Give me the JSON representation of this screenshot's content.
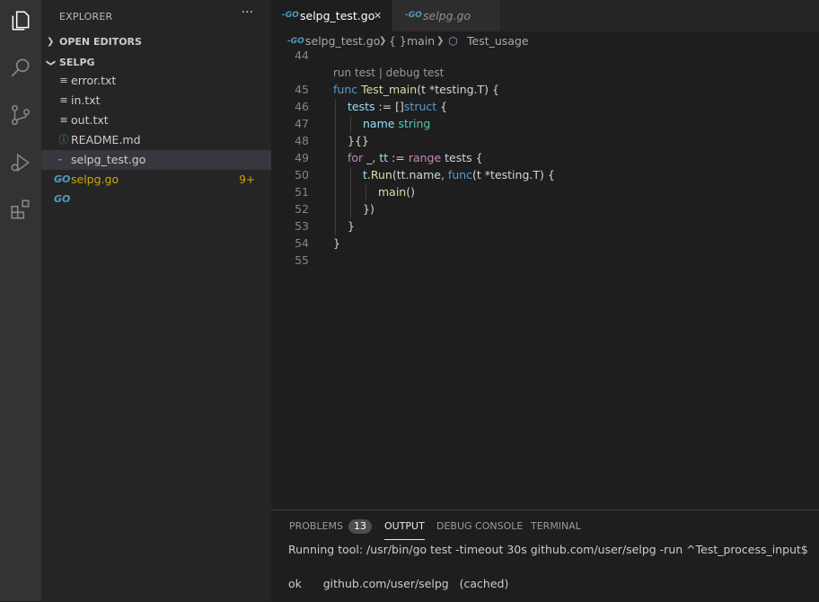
{
  "sidebar": {
    "title": "EXPLORER",
    "more": "···",
    "open_editors": "OPEN EDITORS",
    "folder": "SELPG",
    "files": [
      {
        "name": "error.txt",
        "icon": "lines"
      },
      {
        "name": "in.txt",
        "icon": "lines"
      },
      {
        "name": "out.txt",
        "icon": "lines"
      },
      {
        "name": "README.md",
        "icon": "info"
      },
      {
        "name": "selpg_test.go",
        "icon": "go"
      },
      {
        "name": "selpg.go",
        "icon": "go",
        "badge": "9+"
      }
    ]
  },
  "tabs": [
    {
      "label": "selpg_test.go",
      "close": "✕"
    },
    {
      "label": "selpg.go"
    }
  ],
  "breadcrumb": {
    "file": "selpg_test.go",
    "scope_icon": "{ }",
    "scope": "main",
    "symbol": "Test_usage"
  },
  "editor": {
    "codelens": "run test | debug test",
    "lines": [
      {
        "n": "44"
      },
      {
        "n": "45"
      },
      {
        "n": "46"
      },
      {
        "n": "47"
      },
      {
        "n": "48"
      },
      {
        "n": "49"
      },
      {
        "n": "50"
      },
      {
        "n": "51"
      },
      {
        "n": "52"
      },
      {
        "n": "53"
      },
      {
        "n": "54"
      },
      {
        "n": "55"
      }
    ],
    "tokens": {
      "func": "func",
      "test_main": "Test_main",
      "param1": "(t *testing.T) {",
      "tests": "tests",
      "assign": " := []",
      "struct": "struct",
      "brace_open": " {",
      "name": "name",
      "string": "string",
      "close_lit": "}{}",
      "for": "for",
      "underscore": " _, ",
      "tt": "tt",
      "assign2": " := ",
      "range": "range",
      "tests2": " tests {",
      "t": "t",
      "run": ".Run",
      "run_args": "(tt.name, ",
      "func2": "func",
      "param2": "(t *testing.T) {",
      "main": "main",
      "parens": "()",
      "close_call": "})",
      "close_for": "}",
      "close_func": "}"
    }
  },
  "panel": {
    "tabs": [
      {
        "label": "PROBLEMS",
        "badge": "13"
      },
      {
        "label": "OUTPUT"
      },
      {
        "label": "DEBUG CONSOLE"
      },
      {
        "label": "TERMINAL"
      }
    ],
    "output": [
      "Running tool: /usr/bin/go test -timeout 30s github.com/user/selpg -run ^Test_process_input$",
      "ok      github.com/user/selpg   (cached)"
    ]
  }
}
